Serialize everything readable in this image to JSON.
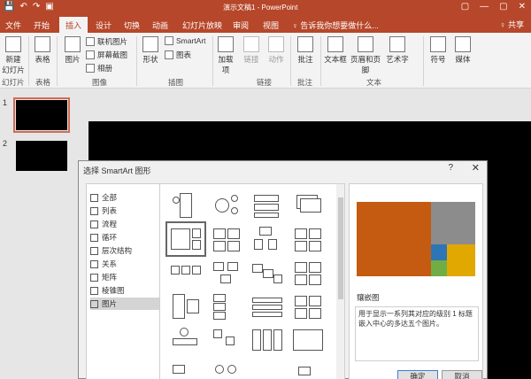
{
  "titlebar": {
    "doc_title": "演示文稿1 - PowerPoint",
    "qat": [
      "💾",
      "↶",
      "↷",
      "▣"
    ],
    "controls": [
      "▢",
      "—",
      "▢",
      "✕"
    ]
  },
  "tabs": [
    "文件",
    "开始",
    "插入",
    "设计",
    "切换",
    "动画",
    "幻灯片放映",
    "审阅",
    "视图"
  ],
  "active_tab": "插入",
  "search_placeholder": "♀ 告诉我你想要做什么...",
  "share_label": "♀ 共享",
  "ribbon": {
    "new_slide": "新建\n幻灯片",
    "table": "表格",
    "picture": "图片",
    "online_picture": "联机图片",
    "screenshot": "屏幕截图",
    "album": "相册",
    "shapes": "形状",
    "smartart": "SmartArt",
    "chart": "图表",
    "addins": "加载\n项",
    "link": "链接",
    "action": "动作",
    "comment": "批注",
    "textbox": "文本框",
    "header_footer": "页眉和页脚",
    "wordart": "艺术字",
    "symbol": "符号",
    "media": "媒体",
    "groups": [
      "幻灯片",
      "表格",
      "图像",
      "插图",
      "链接",
      "批注",
      "文本"
    ]
  },
  "slides": [
    "1",
    "2"
  ],
  "dialog": {
    "title": "选择 SmartArt 图形",
    "help": "?",
    "close": "✕",
    "categories": [
      "全部",
      "列表",
      "流程",
      "循环",
      "层次结构",
      "关系",
      "矩阵",
      "棱锥图",
      "图片"
    ],
    "selected_category": "图片",
    "preview_name": "镶嵌图",
    "preview_desc": "用于显示一系列其对应的级别 1 标题嵌入中心的多达五个图片。",
    "ok": "确定",
    "cancel": "取消",
    "colors": {
      "orange": "#c55a11",
      "gray": "#8c8c8c",
      "blue": "#2e75b6",
      "green": "#70ad47",
      "yellow": "#e0a800"
    }
  }
}
